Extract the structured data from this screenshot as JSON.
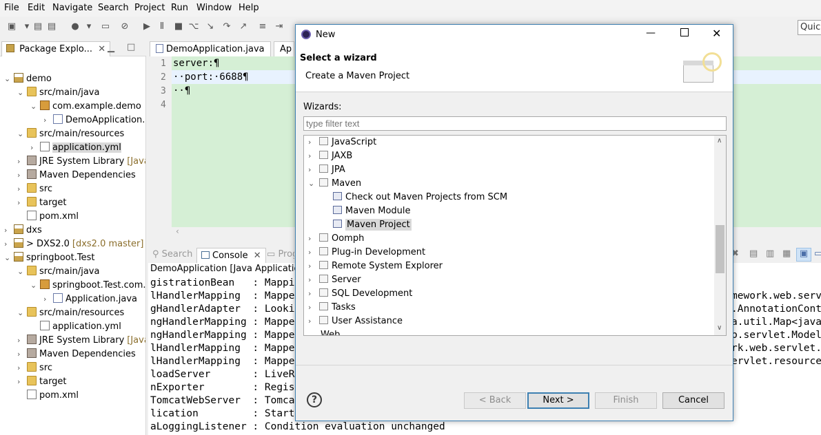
{
  "menubar": [
    "File",
    "Edit",
    "Navigate",
    "Search",
    "Project",
    "Run",
    "Window",
    "Help"
  ],
  "quick_access": "Quick",
  "package_explorer": {
    "tab_label": "Package Explo...",
    "items": [
      {
        "label": "demo",
        "depth": 0,
        "type": "project",
        "expanded": true
      },
      {
        "label": "src/main/java",
        "depth": 1,
        "type": "folder",
        "expanded": true
      },
      {
        "label": "com.example.demo",
        "depth": 2,
        "type": "package",
        "expanded": true
      },
      {
        "label": "DemoApplication.",
        "depth": 3,
        "type": "java",
        "expanded": false
      },
      {
        "label": "src/main/resources",
        "depth": 1,
        "type": "folder",
        "expanded": true
      },
      {
        "label": "application.yml",
        "depth": 2,
        "type": "file",
        "selected": true
      },
      {
        "label": "JRE System Library",
        "extra": "[Java",
        "depth": 1,
        "type": "lib"
      },
      {
        "label": "Maven Dependencies",
        "depth": 1,
        "type": "lib"
      },
      {
        "label": "src",
        "depth": 1,
        "type": "folder"
      },
      {
        "label": "target",
        "depth": 1,
        "type": "folder"
      },
      {
        "label": "pom.xml",
        "depth": 1,
        "type": "file",
        "leaf": true
      },
      {
        "label": "dxs",
        "depth": 0,
        "type": "project"
      },
      {
        "label": "> DXS2.0",
        "extra": "[dxs2.0 master]",
        "depth": 0,
        "type": "project"
      },
      {
        "label": "springboot.Test",
        "depth": 0,
        "type": "project",
        "expanded": true
      },
      {
        "label": "src/main/java",
        "depth": 1,
        "type": "folder",
        "expanded": true
      },
      {
        "label": "springboot.Test.com.",
        "depth": 2,
        "type": "package",
        "expanded": true
      },
      {
        "label": "Application.java",
        "depth": 3,
        "type": "java"
      },
      {
        "label": "src/main/resources",
        "depth": 1,
        "type": "folder",
        "expanded": true
      },
      {
        "label": "application.yml",
        "depth": 2,
        "type": "file",
        "leaf": true
      },
      {
        "label": "JRE System Library",
        "extra": "[Java",
        "depth": 1,
        "type": "lib"
      },
      {
        "label": "Maven Dependencies",
        "depth": 1,
        "type": "lib"
      },
      {
        "label": "src",
        "depth": 1,
        "type": "folder"
      },
      {
        "label": "target",
        "depth": 1,
        "type": "folder"
      },
      {
        "label": "pom.xml",
        "depth": 1,
        "type": "file",
        "leaf": true
      }
    ]
  },
  "editor": {
    "tabs": [
      "DemoApplication.java",
      "Ap"
    ],
    "lines": [
      "1",
      "2",
      "3",
      "4"
    ],
    "code": [
      "server:¶",
      "··port:·6688¶",
      "··¶",
      ""
    ]
  },
  "bottom": {
    "tabs": [
      "Search",
      "Console",
      "Prog"
    ],
    "console_header": "DemoApplication [Java Application]",
    "left_lines": [
      "gistrationBean   : Mappi",
      "lHandlerMapping  : Mappe",
      "gHandlerAdapter  : Looki",
      "ngHandlerMapping : Mappe",
      "ngHandlerMapping : Mappe",
      "lHandlerMapping  : Mappe",
      "lHandlerMapping  : Mappe",
      "loadServer       : LiveR",
      "nExporter        : Regis",
      "TomcatWebServer  : Tomca",
      "lication         : Start",
      "aLoggingListener : Condition evaluation unchanged"
    ],
    "right_lines": [
      "mework.web.serv",
      ".AnnotationCont",
      "a.util.Map<java",
      "b.servlet.Model",
      "rk.web.servlet.",
      "ervlet.resource"
    ]
  },
  "dialog": {
    "title": "New",
    "header_title": "Select a wizard",
    "header_subtitle": "Create a Maven Project",
    "wizards_label": "Wizards:",
    "filter_placeholder": "type filter text",
    "items": [
      {
        "label": "JavaScript",
        "depth": 0,
        "expanded": false
      },
      {
        "label": "JAXB",
        "depth": 0,
        "expanded": false
      },
      {
        "label": "JPA",
        "depth": 0,
        "expanded": false
      },
      {
        "label": "Maven",
        "depth": 0,
        "expanded": true
      },
      {
        "label": "Check out Maven Projects from SCM",
        "depth": 1
      },
      {
        "label": "Maven Module",
        "depth": 1
      },
      {
        "label": "Maven Project",
        "depth": 1,
        "selected": true
      },
      {
        "label": "Oomph",
        "depth": 0,
        "expanded": false
      },
      {
        "label": "Plug-in Development",
        "depth": 0,
        "expanded": false
      },
      {
        "label": "Remote System Explorer",
        "depth": 0,
        "expanded": false
      },
      {
        "label": "Server",
        "depth": 0,
        "expanded": false
      },
      {
        "label": "SQL Development",
        "depth": 0,
        "expanded": false
      },
      {
        "label": "Tasks",
        "depth": 0,
        "expanded": false
      },
      {
        "label": "User Assistance",
        "depth": 0,
        "expanded": false
      }
    ],
    "buttons": {
      "back": "< Back",
      "next": "Next >",
      "finish": "Finish",
      "cancel": "Cancel"
    }
  }
}
